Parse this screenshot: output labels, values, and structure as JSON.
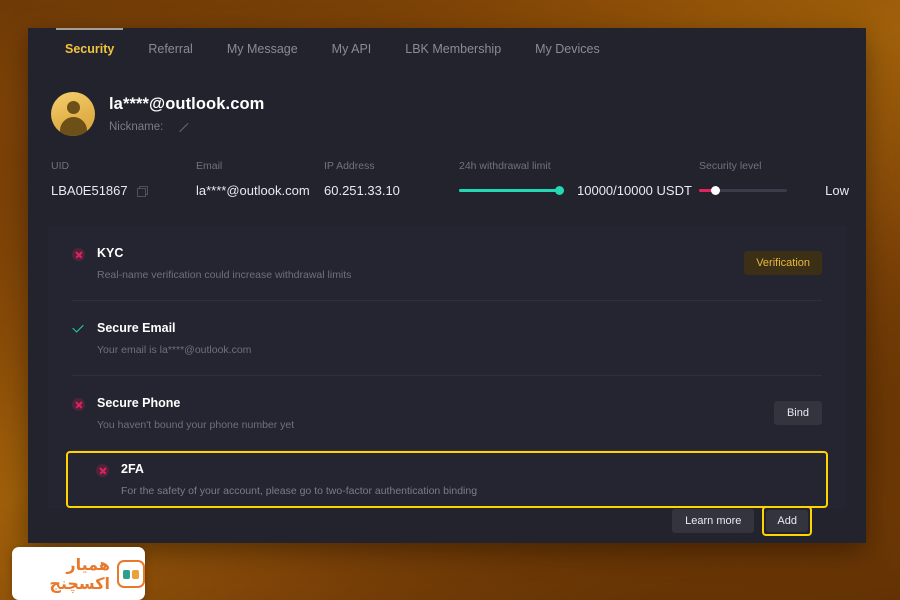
{
  "tabs": [
    {
      "label": "Security",
      "active": true
    },
    {
      "label": "Referral",
      "active": false
    },
    {
      "label": "My Message",
      "active": false
    },
    {
      "label": "My API",
      "active": false
    },
    {
      "label": "LBK Membership",
      "active": false
    },
    {
      "label": "My Devices",
      "active": false
    }
  ],
  "profile": {
    "email": "la****@outlook.com",
    "nickname_label": "Nickname:",
    "edit_icon": "pencil-icon",
    "avatar_icon": "user-avatar-icon"
  },
  "stats": {
    "uid": {
      "label": "UID",
      "value": "LBA0E51867",
      "copy_icon": "copy-icon"
    },
    "email": {
      "label": "Email",
      "value": "la****@outlook.com"
    },
    "ip": {
      "label": "IP Address",
      "value": "60.251.33.10"
    },
    "withdrawal": {
      "label": "24h withdrawal limit",
      "value": "10000/10000 USDT",
      "percent": 100,
      "color": "#23d8b4"
    },
    "security_level": {
      "label": "Security level",
      "value": "Low",
      "percent": 18,
      "color": "#e4215b"
    }
  },
  "security_items": [
    {
      "title": "KYC",
      "desc": "Real-name verification could increase withdrawal limits",
      "status": "bad",
      "status_icon": "x-circle-icon",
      "buttons": [
        {
          "label": "Verification",
          "style": "verification"
        }
      ],
      "highlighted": false
    },
    {
      "title": "Secure Email",
      "desc": "Your email is la****@outlook.com",
      "status": "good",
      "status_icon": "check-icon",
      "buttons": [],
      "highlighted": false
    },
    {
      "title": "Secure Phone",
      "desc": "You haven't bound your phone number yet",
      "status": "bad",
      "status_icon": "x-circle-icon",
      "buttons": [
        {
          "label": "Bind",
          "style": "plain"
        }
      ],
      "highlighted": false
    },
    {
      "title": "2FA",
      "desc": "For the safety of your account, please go to two-factor authentication binding",
      "status": "bad",
      "status_icon": "x-circle-icon",
      "buttons": [
        {
          "label": "Learn more",
          "style": "plain"
        },
        {
          "label": "Add",
          "style": "plain-highlighted"
        }
      ],
      "highlighted": true
    }
  ],
  "watermark": {
    "text": "همیار اکسچنج",
    "logo_icon": "hamyar-exchange-logo-icon",
    "accent": "#e8782a"
  },
  "colors": {
    "accent_yellow": "#f2c33d",
    "highlight_yellow": "#ffd400",
    "teal": "#23d8b4",
    "red": "#e4215b",
    "card_bg": "#23232e"
  }
}
